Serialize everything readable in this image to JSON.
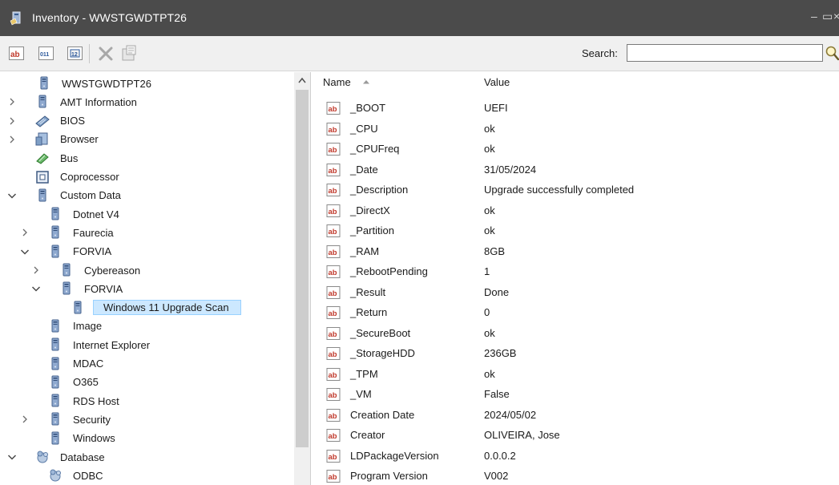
{
  "window": {
    "title": "Inventory - WWSTGWDTPT26",
    "minimize_glyph": "–",
    "maximize_glyph": "▭",
    "close_glyph": "×"
  },
  "toolbar": {
    "buttons": [
      "string-value-icon",
      "binary-value-icon",
      "number-value-icon",
      "delete-icon",
      "properties-icon"
    ],
    "search_label": "Search:",
    "search_value": "",
    "search_placeholder": ""
  },
  "tree": {
    "items": [
      {
        "label": "WWSTGWDTPT26",
        "depth": 0,
        "expander": "none",
        "icon": "computer-icon",
        "selected": false
      },
      {
        "label": "AMT Information",
        "depth": 0,
        "expander": "collapsed",
        "icon": "computer-icon",
        "selected": false
      },
      {
        "label": "BIOS",
        "depth": 0,
        "expander": "collapsed",
        "icon": "chip-icon",
        "selected": false
      },
      {
        "label": "Browser",
        "depth": 0,
        "expander": "collapsed",
        "icon": "browser-icon",
        "selected": false
      },
      {
        "label": "Bus",
        "depth": 0,
        "expander": "none",
        "icon": "bus-icon",
        "selected": false
      },
      {
        "label": "Coprocessor",
        "depth": 0,
        "expander": "none",
        "icon": "coprocessor-icon",
        "selected": false
      },
      {
        "label": "Custom Data",
        "depth": 0,
        "expander": "expanded",
        "icon": "computer-icon",
        "selected": false
      },
      {
        "label": "Dotnet V4",
        "depth": 1,
        "expander": "none",
        "icon": "computer-icon",
        "selected": false
      },
      {
        "label": "Faurecia",
        "depth": 1,
        "expander": "collapsed",
        "icon": "computer-icon",
        "selected": false
      },
      {
        "label": "FORVIA",
        "depth": 1,
        "expander": "expanded",
        "icon": "computer-icon",
        "selected": false
      },
      {
        "label": "Cybereason",
        "depth": 2,
        "expander": "collapsed",
        "icon": "computer-icon",
        "selected": false
      },
      {
        "label": "FORVIA",
        "depth": 2,
        "expander": "expanded",
        "icon": "computer-icon",
        "selected": false
      },
      {
        "label": "Windows 11 Upgrade Scan",
        "depth": 3,
        "expander": "none",
        "icon": "computer-icon",
        "selected": true
      },
      {
        "label": "Image",
        "depth": 1,
        "expander": "none",
        "icon": "computer-icon",
        "selected": false
      },
      {
        "label": "Internet Explorer",
        "depth": 1,
        "expander": "none",
        "icon": "computer-icon",
        "selected": false
      },
      {
        "label": "MDAC",
        "depth": 1,
        "expander": "none",
        "icon": "computer-icon",
        "selected": false
      },
      {
        "label": "O365",
        "depth": 1,
        "expander": "none",
        "icon": "computer-icon",
        "selected": false
      },
      {
        "label": "RDS Host",
        "depth": 1,
        "expander": "none",
        "icon": "computer-icon",
        "selected": false
      },
      {
        "label": "Security",
        "depth": 1,
        "expander": "collapsed",
        "icon": "computer-icon",
        "selected": false
      },
      {
        "label": "Windows",
        "depth": 1,
        "expander": "none",
        "icon": "computer-icon",
        "selected": false
      },
      {
        "label": "Database",
        "depth": 0,
        "expander": "expanded",
        "icon": "database-icon",
        "selected": false
      },
      {
        "label": "ODBC",
        "depth": 1,
        "expander": "none",
        "icon": "database-icon",
        "selected": false
      }
    ]
  },
  "list": {
    "columns": {
      "name": "Name",
      "value": "Value"
    },
    "sort": "ascending",
    "rows": [
      {
        "name": "_BOOT",
        "value": "UEFI"
      },
      {
        "name": "_CPU",
        "value": "ok"
      },
      {
        "name": "_CPUFreq",
        "value": "ok"
      },
      {
        "name": "_Date",
        "value": "31/05/2024"
      },
      {
        "name": "_Description",
        "value": "Upgrade successfully completed"
      },
      {
        "name": "_DirectX",
        "value": "ok"
      },
      {
        "name": "_Partition",
        "value": "ok"
      },
      {
        "name": "_RAM",
        "value": "8GB"
      },
      {
        "name": "_RebootPending",
        "value": "1"
      },
      {
        "name": "_Result",
        "value": "Done"
      },
      {
        "name": "_Return",
        "value": "0"
      },
      {
        "name": "_SecureBoot",
        "value": "ok"
      },
      {
        "name": "_StorageHDD",
        "value": "236GB"
      },
      {
        "name": "_TPM",
        "value": "ok"
      },
      {
        "name": "_VM",
        "value": "False"
      },
      {
        "name": "Creation Date",
        "value": "2024/05/02"
      },
      {
        "name": "Creator",
        "value": "OLIVEIRA, Jose"
      },
      {
        "name": "LDPackageVersion",
        "value": "0.0.0.2"
      },
      {
        "name": "Program Version",
        "value": "V002"
      }
    ]
  },
  "colors": {
    "titlebar": "#4b4b4b",
    "selection": "#cce8ff",
    "accent": "#1e6ec8"
  }
}
